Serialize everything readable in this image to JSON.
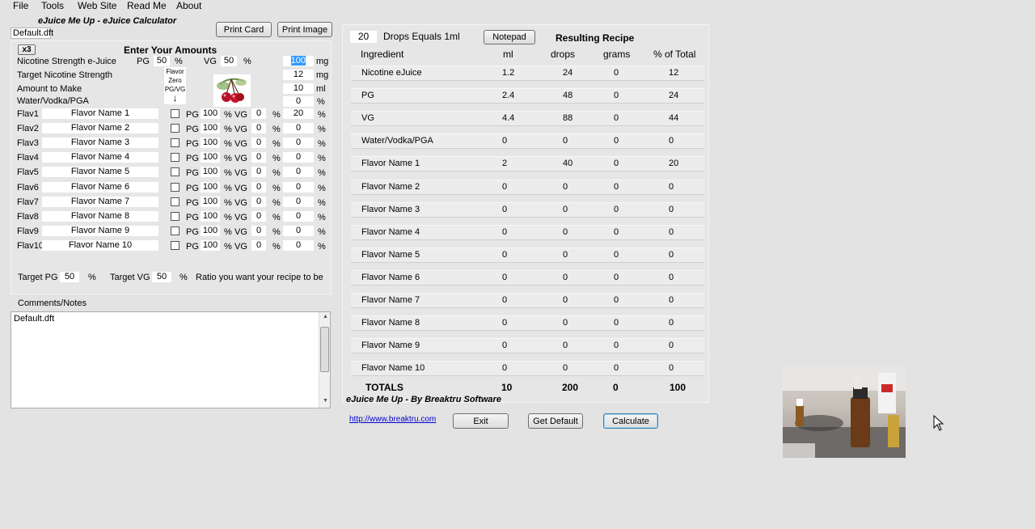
{
  "menu": [
    "File",
    "Tools",
    "Web Site",
    "Read Me",
    "About"
  ],
  "app_title": "eJuice Me Up - eJuice Calculator",
  "file_name": "Default.dft",
  "buttons": {
    "print_card": "Print Card",
    "print_image": "Print Image",
    "notepad": "Notepad",
    "exit": "Exit",
    "get_default": "Get Default",
    "calculate": "Calculate",
    "x3": "x3"
  },
  "inputs": {
    "heading": "Enter Your Amounts",
    "nicotine_label": "Nicotine Strength e-Juice",
    "nic_pg_label": "PG",
    "nic_pg": "50",
    "pct": "%",
    "nic_vg_label": "VG",
    "nic_vg": "50",
    "nic_strength": "100",
    "nic_unit": "mg",
    "target_label": "Target Nicotine Strength",
    "target_value": "12",
    "target_unit": "mg",
    "amount_label": "Amount to Make",
    "amount_value": "10",
    "amount_unit": "ml",
    "water_label": "Water/Vodka/PGA",
    "water_value": "0",
    "water_unit": "%",
    "flavor_zero": [
      "Flavor",
      "Zero",
      "PG/VG"
    ],
    "arrow": "↓"
  },
  "flavors": [
    {
      "id": "Flav1",
      "name": "Flavor Name 1",
      "pg": "100",
      "vg": "0",
      "pct": "20"
    },
    {
      "id": "Flav2",
      "name": "Flavor Name 2",
      "pg": "100",
      "vg": "0",
      "pct": "0"
    },
    {
      "id": "Flav3",
      "name": "Flavor Name 3",
      "pg": "100",
      "vg": "0",
      "pct": "0"
    },
    {
      "id": "Flav4",
      "name": "Flavor Name 4",
      "pg": "100",
      "vg": "0",
      "pct": "0"
    },
    {
      "id": "Flav5",
      "name": "Flavor Name 5",
      "pg": "100",
      "vg": "0",
      "pct": "0"
    },
    {
      "id": "Flav6",
      "name": "Flavor Name 6",
      "pg": "100",
      "vg": "0",
      "pct": "0"
    },
    {
      "id": "Flav7",
      "name": "Flavor Name 7",
      "pg": "100",
      "vg": "0",
      "pct": "0"
    },
    {
      "id": "Flav8",
      "name": "Flavor Name 8",
      "pg": "100",
      "vg": "0",
      "pct": "0"
    },
    {
      "id": "Flav9",
      "name": "Flavor Name 9",
      "pg": "100",
      "vg": "0",
      "pct": "0"
    },
    {
      "id": "Flav10",
      "name": "Flavor Name 10",
      "pg": "100",
      "vg": "0",
      "pct": "0"
    }
  ],
  "flavor_labels": {
    "pg": "PG",
    "vg": "VG",
    "pct": "%"
  },
  "target_ratio": {
    "pg_label": "Target PG",
    "pg": "50",
    "pct": "%",
    "vg_label": "Target VG",
    "vg": "50",
    "note": "Ratio you want your recipe to be"
  },
  "comments": {
    "label": "Comments/Notes",
    "text": "Default.dft"
  },
  "recipe": {
    "drops": "20",
    "drops_label": "Drops Equals 1ml",
    "title": "Resulting Recipe",
    "columns": [
      "Ingredient",
      "ml",
      "drops",
      "grams",
      "% of Total"
    ],
    "rows": [
      [
        "Nicotine eJuice",
        "1.2",
        "24",
        "0",
        "12"
      ],
      [
        "PG",
        "2.4",
        "48",
        "0",
        "24"
      ],
      [
        "VG",
        "4.4",
        "88",
        "0",
        "44"
      ],
      [
        "Water/Vodka/PGA",
        "0",
        "0",
        "0",
        "0"
      ],
      [
        "Flavor Name 1",
        "2",
        "40",
        "0",
        "20"
      ],
      [
        "Flavor Name 2",
        "0",
        "0",
        "0",
        "0"
      ],
      [
        "Flavor Name 3",
        "0",
        "0",
        "0",
        "0"
      ],
      [
        "Flavor Name 4",
        "0",
        "0",
        "0",
        "0"
      ],
      [
        "Flavor Name 5",
        "0",
        "0",
        "0",
        "0"
      ],
      [
        "Flavor Name 6",
        "0",
        "0",
        "0",
        "0"
      ],
      [
        "Flavor Name 7",
        "0",
        "0",
        "0",
        "0"
      ],
      [
        "Flavor Name 8",
        "0",
        "0",
        "0",
        "0"
      ],
      [
        "Flavor Name 9",
        "0",
        "0",
        "0",
        "0"
      ],
      [
        "Flavor Name 10",
        "0",
        "0",
        "0",
        "0"
      ]
    ],
    "totals": [
      "TOTALS",
      "10",
      "200",
      "0",
      "100"
    ]
  },
  "footer_credit": "eJuice Me Up -  By Breaktru Software",
  "link": "http://www.breaktru.com"
}
